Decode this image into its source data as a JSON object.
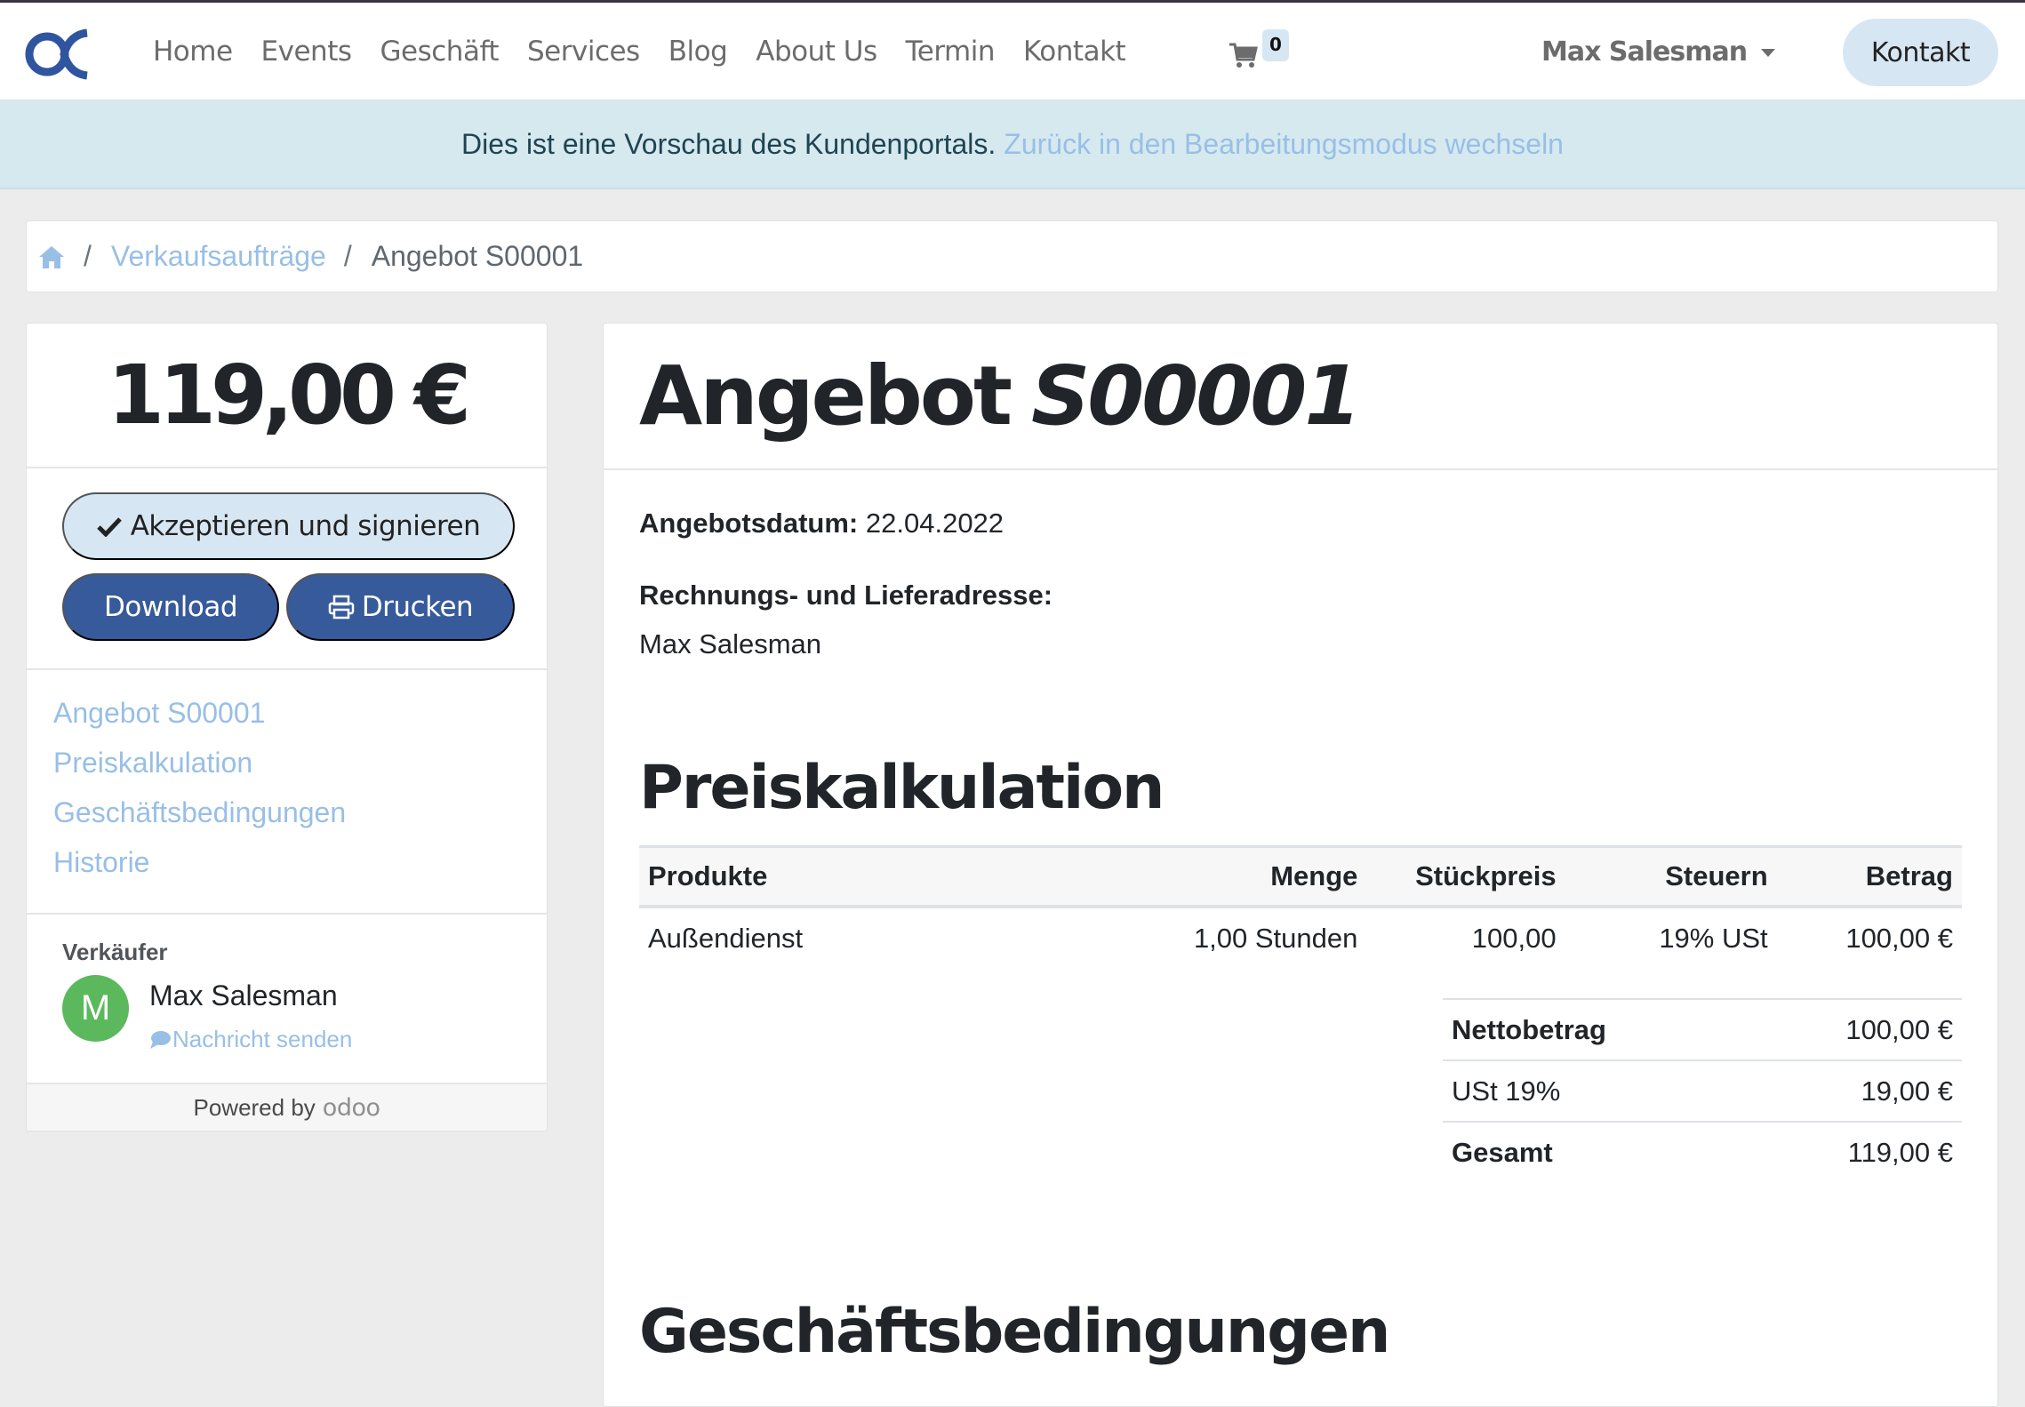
{
  "navbar": {
    "logo": "alpha-logo",
    "links": [
      "Home",
      "Events",
      "Geschäft",
      "Services",
      "Blog",
      "About Us",
      "Termin",
      "Kontakt"
    ],
    "cart_count": "0",
    "user_name": "Max Salesman",
    "cta_label": "Kontakt"
  },
  "banner": {
    "text": "Dies ist eine Vorschau des Kundenportals.",
    "link": "Zurück in den Bearbeitungsmodus wechseln"
  },
  "breadcrumb": {
    "items": [
      "Verkaufsaufträge",
      "Angebot S00001"
    ],
    "separator": "/"
  },
  "sidebar": {
    "amount": "119,00 €",
    "accept_label": "Akzeptieren und signieren",
    "download_label": "Download",
    "print_label": "Drucken",
    "toc": [
      "Angebot S00001",
      "Preiskalkulation",
      "Geschäftsbedingungen",
      "Historie"
    ],
    "seller_label": "Verkäufer",
    "seller_initial": "M",
    "seller_name": "Max Salesman",
    "message_label": "Nachricht senden",
    "powered_by": "Powered by",
    "powered_brand": "odoo"
  },
  "document": {
    "title_prefix": "Angebot",
    "title_number": "S00001",
    "date_label": "Angebotsdatum:",
    "date_value": "22.04.2022",
    "address_label": "Rechnungs- und Lieferadresse:",
    "address_value": "Max Salesman",
    "pricing_heading": "Preiskalkulation",
    "terms_heading": "Geschäftsbedingungen",
    "table": {
      "headers": [
        "Produkte",
        "Menge",
        "Stückpreis",
        "Steuern",
        "Betrag"
      ],
      "rows": [
        [
          "Außendienst",
          "1,00 Stunden",
          "100,00",
          "19% USt",
          "100,00 €"
        ]
      ]
    },
    "totals": [
      {
        "label": "Nettobetrag",
        "value": "100,00 €"
      },
      {
        "label": "USt 19%",
        "value": "19,00 €"
      },
      {
        "label": "Gesamt",
        "value": "119,00 €"
      }
    ]
  },
  "colors": {
    "primary": "#375a9b",
    "light_button": "#d7e6f3",
    "link": "#98bfe6",
    "banner_bg": "#d6e9ef",
    "avatar": "#5cb85c"
  }
}
